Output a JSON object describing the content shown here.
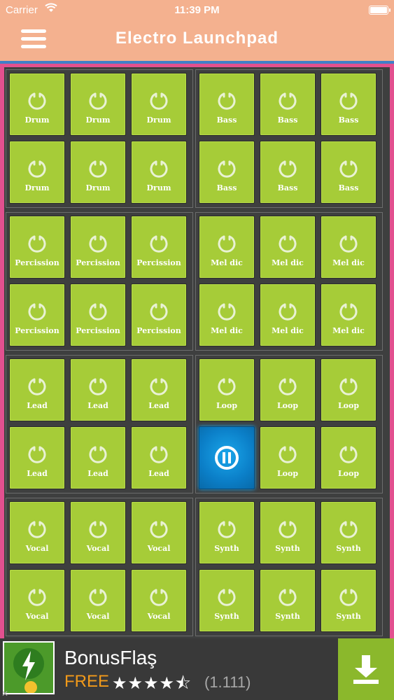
{
  "status_bar": {
    "carrier": "Carrier",
    "time": "11:39 PM"
  },
  "header": {
    "title": "Electro Launchpad",
    "menu_icon": "hamburger-menu-icon"
  },
  "sections": [
    {
      "name": "drum",
      "labels": [
        "Drum",
        "Drum",
        "Drum",
        "Drum",
        "Drum",
        "Drum"
      ]
    },
    {
      "name": "bass",
      "labels": [
        "Bass",
        "Bass",
        "Bass",
        "Bass",
        "Bass",
        "Bass"
      ]
    },
    {
      "name": "percussion",
      "labels": [
        "Percission",
        "Percission",
        "Percission",
        "Percission",
        "Percission",
        "Percission"
      ]
    },
    {
      "name": "melodic",
      "labels": [
        "Mel dic",
        "Mel dic",
        "Mel dic",
        "Mel dic",
        "Mel dic",
        "Mel dic"
      ]
    },
    {
      "name": "lead",
      "labels": [
        "Lead",
        "Lead",
        "Lead",
        "Lead",
        "Lead",
        "Lead"
      ]
    },
    {
      "name": "loop",
      "labels": [
        "Loop",
        "Loop",
        "Loop",
        "",
        "Loop",
        "Loop"
      ],
      "active_index": 3
    },
    {
      "name": "vocal",
      "labels": [
        "Vocal",
        "Vocal",
        "Vocal",
        "Vocal",
        "Vocal",
        "Vocal"
      ]
    },
    {
      "name": "synth",
      "labels": [
        "Synth",
        "Synth",
        "Synth",
        "Synth",
        "Synth",
        "Synth"
      ]
    }
  ],
  "colors": {
    "pad": "#a6cc38",
    "pad_active": "#0b7fc8",
    "board_border": "#e2508f",
    "header": "#f4b18f"
  },
  "ad": {
    "title": "BonusFlaş",
    "price": "FREE",
    "stars": "★★★★⯪",
    "rating_value": 4.5,
    "reviews": "(1.111)",
    "download_icon": "download-icon"
  }
}
